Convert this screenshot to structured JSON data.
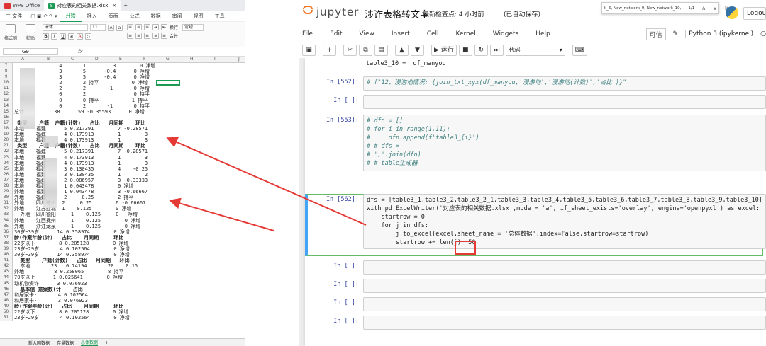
{
  "wps": {
    "tabs": [
      "WPS Office",
      "对应表的相关数据.xlsx"
    ],
    "menu": [
      "三 文件",
      "开始",
      "插入",
      "页面",
      "公式",
      "数据",
      "审阅",
      "视图",
      "工具",
      "会员专享",
      "效率"
    ],
    "toolbar": {
      "paste": "粘贴",
      "format_painter": "格式刷",
      "font": "宋体",
      "size": "11",
      "wrap": "换行",
      "normal": "常规",
      "merge": "合并"
    },
    "name_box": "G9",
    "fx": "fx",
    "columns": [
      "A",
      "B",
      "C",
      "D",
      "E",
      "F",
      "G",
      "H",
      "I",
      "J"
    ],
    "rows": [
      {
        "n": "7",
        "t": "               4       1         3        0 净增"
      },
      {
        "n": "8",
        "t": "               3       5      -0.4      0 净增"
      },
      {
        "n": "9",
        "t": "               3       5      -0.4      0 净增"
      },
      {
        "n": "10",
        "t": "               2       2 持平           0 净增"
      },
      {
        "n": "11",
        "t": "               2       2       -1       0 净增"
      },
      {
        "n": "12",
        "t": "               0       2                0 持平"
      },
      {
        "n": "13",
        "t": "               0       0 持平           1 持平"
      },
      {
        "n": "14",
        "t": "               0       2       -1       0 持平"
      },
      {
        "n": "15",
        "t": "总计          38      59 -0.35593      0 净增"
      },
      {
        "n": "16",
        "t": ""
      },
      {
        "n": "17",
        "t": " 类型    户籍  户籍(计数)   占比   月同期    环比"
      },
      {
        "n": "18",
        "t": "本地    福建      5 0.217391        7 -0.28571"
      },
      {
        "n": "19",
        "t": "本地    福建      4 0.173913        1        3"
      },
      {
        "n": "20",
        "t": "本地    福建      4 0.173913        1        3"
      },
      {
        "n": "21",
        "t": " 类型    户籍  户籍(计数)   占比   月同期    环比"
      },
      {
        "n": "22",
        "t": "本地    福建      5 0.217391        7 -0.28571"
      },
      {
        "n": "23",
        "t": "本地    福建      4 0.173913        1        3"
      },
      {
        "n": "24",
        "t": "本地    福建      4 0.173913        1        3"
      },
      {
        "n": "25",
        "t": "本地    福建      3 0.130435        4    -0.25"
      },
      {
        "n": "26",
        "t": "本地    福建      3 0.130435        1        2"
      },
      {
        "n": "27",
        "t": "本地    福建      2 0.086957        3 -0.33333"
      },
      {
        "n": "28",
        "t": "本地    福建      1 0.043478        0 净增"
      },
      {
        "n": "29",
        "t": "外地    福建      1 0.043478        3 -0.66667"
      },
      {
        "n": "30",
        "t": "外地    福建      2     0.25        2 持平"
      },
      {
        "n": "31",
        "t": "外地    四川达州  2     0.25        6 -0.66667"
      },
      {
        "n": "32",
        "t": "外地    江苏盐城  1    0.125        0 净增"
      },
      {
        "n": "33",
        "t": "  外地  四川德阳     1    0.125     0   净增"
      },
      {
        "n": "34",
        "t": "外地    江西抚州     1    0.125        0 净增"
      },
      {
        "n": "35",
        "t": "外地    浙江龙泉     1    0.125        0 净增"
      },
      {
        "n": "36",
        "t": "30岁~39岁      14 0.358974        0 净增"
      },
      {
        "n": "37",
        "t": "龄(作案年龄(计)   占比    月同期     环比"
      },
      {
        "n": "38",
        "t": "22岁以下        8 0.205128        0 净增"
      },
      {
        "n": "39",
        "t": "23岁~29岁       4 0.102564        0 净增"
      },
      {
        "n": "40",
        "t": "30岁~39岁      14 0.358974        0 净增"
      },
      {
        "n": "41",
        "t": "  类型    户籍(计数)   占比   月同期   环比"
      },
      {
        "n": "42",
        "t": "  本地       23   0.74194       20    0.15"
      },
      {
        "n": "43",
        "t": "外地          8 0.258065        8 持平"
      },
      {
        "n": "44",
        "t": "70岁以上      1 0.025641        0 净增"
      },
      {
        "n": "45",
        "t": "动机物资诈      3 0.076923"
      },
      {
        "n": "46",
        "t": "  基本信 意案数(计    占比"
      },
      {
        "n": "47",
        "t": "和居家卡·       4 0.102564"
      },
      {
        "n": "48",
        "t": "和居家卡·       3 0.076923"
      },
      {
        "n": "49",
        "t": "龄(作案年龄(计)   占比    月同期     环比"
      },
      {
        "n": "50",
        "t": "22岁以下        8 0.205128        0 净增"
      },
      {
        "n": "51",
        "t": "23岁~29岁       4 0.102564        0 净增"
      }
    ],
    "sheets": [
      "新入网数据",
      "存量数据",
      "总体数据"
    ]
  },
  "jupyter": {
    "brand": "jupyter",
    "title": "涉诈表格转文字",
    "checkpoint": "最新检查点: 4 小时前",
    "saved": "(已自动保存)",
    "find_bar": {
      "text": "k_6, New_network_9, New_network_10,",
      "count": "1/1"
    },
    "logout": "Logout",
    "menu": [
      "File",
      "Edit",
      "View",
      "Insert",
      "Cell",
      "Kernel",
      "Widgets",
      "Help"
    ],
    "trusted": "可信",
    "kernel": "Python 3 (ipykernel)",
    "toolbar": {
      "run": "▶ 运行",
      "cell_type": "代码"
    },
    "cells": [
      {
        "prompt": "",
        "lines": [
          "table3_10 =  df_manyou"
        ]
      },
      {
        "prompt": "In  [552]:",
        "lines": [
          "# f\"12、漫游地情况: {join_txt_xyx(df_manyou,'漫游地','漫游地(计数)','占比')}\""
        ]
      },
      {
        "prompt": "In  [ ]:",
        "lines": [
          ""
        ]
      },
      {
        "prompt": "In  [553]:",
        "lines": [
          "# dfn = []",
          "# for i in range(1,11):",
          "#     dfn.append(f'table3_{i}')",
          "# # dfs =",
          "# ','.join(dfn)",
          "# # table生成器"
        ]
      },
      {
        "prompt": "In  [562]:",
        "lines": [
          "dfs = [table3_1,table3_2,table3_2_1,table3_3,table3_4,table3_5,table3_6,table3_7,table3_8,table3_9,table3_10]",
          "with pd.ExcelWriter('对应表的相关数据.xlsx',mode = 'a', if_sheet_exists='overlay', engine='openpyxl') as excel:",
          "    startrow = 0",
          "    for j in dfs:",
          "        j.to_excel(excel,sheet_name = '总体数据',index=False,startrow=startrow)",
          "        startrow += len(j)  50"
        ]
      },
      {
        "prompt": "In  [ ]:",
        "lines": [
          ""
        ]
      },
      {
        "prompt": "In  [ ]:",
        "lines": [
          ""
        ]
      },
      {
        "prompt": "In  [ ]:",
        "lines": [
          ""
        ]
      },
      {
        "prompt": "In  [ ]:",
        "lines": [
          ""
        ]
      }
    ]
  },
  "colors": {
    "annotation": "#e53935",
    "wps_green": "#1c9b55",
    "jupyter_orange": "#f37726",
    "prompt_blue": "#303f9f"
  }
}
